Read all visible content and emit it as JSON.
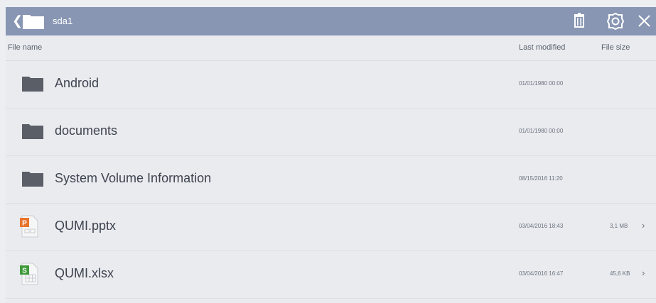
{
  "titlebar": {
    "title": "sda1",
    "back_icon": "chevron-left-icon",
    "folder_icon": "folder-icon",
    "actions": [
      "trash-icon",
      "settings-icon",
      "close-icon"
    ]
  },
  "columns": {
    "name": "File name",
    "modified": "Last modified",
    "size": "File size"
  },
  "files": [
    {
      "name": "Android",
      "type": "folder",
      "modified": "01/01/1980 00:00",
      "size": ""
    },
    {
      "name": "documents",
      "type": "folder",
      "modified": "01/01/1980 00:00",
      "size": ""
    },
    {
      "name": "System Volume Information",
      "type": "folder",
      "modified": "08/15/2016 11:20",
      "size": ""
    },
    {
      "name": "QUMI.pptx",
      "type": "pptx",
      "modified": "03/04/2016 18:43",
      "size": "3,1 MB",
      "arrow": "›"
    },
    {
      "name": "QUMI.xlsx",
      "type": "xlsx",
      "modified": "03/04/2016 16:47",
      "size": "45,6 KB",
      "arrow": "›"
    }
  ],
  "colors": {
    "titlebar": "#8896b4",
    "background": "#e9ebee",
    "folder": "#5a5e66",
    "pptx": "#e8732c",
    "xlsx": "#3f9a3a"
  }
}
